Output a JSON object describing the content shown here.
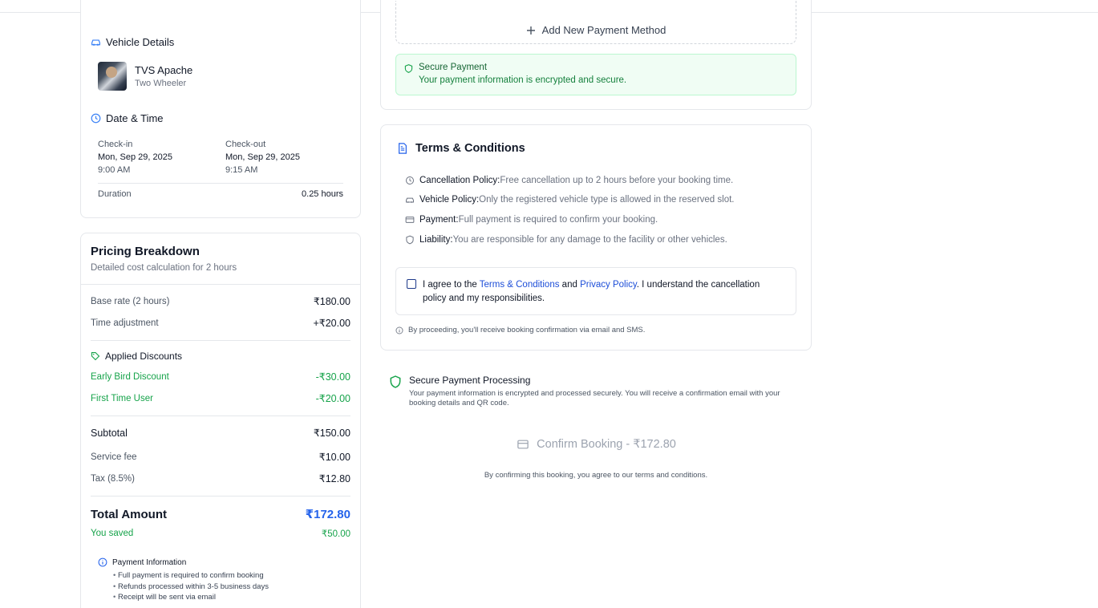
{
  "vehicle": {
    "section_title": "Vehicle Details",
    "name": "TVS Apache",
    "type": "Two Wheeler"
  },
  "datetime": {
    "section_title": "Date & Time",
    "checkin_label": "Check-in",
    "checkin_date": "Mon, Sep 29, 2025",
    "checkin_time": "9:00 AM",
    "checkout_label": "Check-out",
    "checkout_date": "Mon, Sep 29, 2025",
    "checkout_time": "9:15 AM",
    "duration_label": "Duration",
    "duration_value": "0.25 hours"
  },
  "pricing": {
    "title": "Pricing Breakdown",
    "subtitle": "Detailed cost calculation for 2 hours",
    "base_label": "Base rate (2 hours)",
    "base_value": "₹180.00",
    "adj_label": "Time adjustment",
    "adj_value": "+₹20.00",
    "discounts_title": "Applied Discounts",
    "discounts": [
      {
        "label": "Early Bird Discount",
        "value": "-₹30.00"
      },
      {
        "label": "First Time User",
        "value": "-₹20.00"
      }
    ],
    "subtotal_label": "Subtotal",
    "subtotal_value": "₹150.00",
    "service_label": "Service fee",
    "service_value": "₹10.00",
    "tax_label": "Tax (8.5%)",
    "tax_value": "₹12.80",
    "total_label": "Total Amount",
    "total_value": "₹172.80",
    "saved_label": "You saved",
    "saved_value": "₹50.00",
    "info_title": "Payment Information",
    "info_items": [
      "Full payment is required to confirm booking",
      "Refunds processed within 3-5 business days",
      "Receipt will be sent via email"
    ]
  },
  "payment": {
    "add_label": "Add New Payment Method",
    "secure_title": "Secure Payment",
    "secure_text": "Your payment information is encrypted and secure."
  },
  "terms": {
    "title": "Terms & Conditions",
    "policies": [
      {
        "name": "Cancellation Policy:",
        "text": "Free cancellation up to 2 hours before your booking time."
      },
      {
        "name": "Vehicle Policy:",
        "text": "Only the registered vehicle type is allowed in the reserved slot."
      },
      {
        "name": "Payment:",
        "text": "Full payment is required to confirm your booking."
      },
      {
        "name": "Liability:",
        "text": "You are responsible for any damage to the facility or other vehicles."
      }
    ],
    "agree_prefix": "I agree to the ",
    "terms_link": "Terms & Conditions",
    "agree_and": " and ",
    "privacy_link": "Privacy Policy",
    "agree_suffix": ". I understand the cancellation policy and my responsibilities.",
    "notice": "By proceeding, you'll receive booking confirmation via email and SMS."
  },
  "processing": {
    "title": "Secure Payment Processing",
    "text": "Your payment information is encrypted and processed securely. You will receive a confirmation email with your booking details and QR code."
  },
  "confirm": {
    "button_label": "Confirm Booking - ₹172.80",
    "note": "By confirming this booking, you agree to our terms and conditions."
  },
  "colors": {
    "accent": "#2563eb",
    "success": "#16a34a",
    "border": "#e5e7eb"
  }
}
